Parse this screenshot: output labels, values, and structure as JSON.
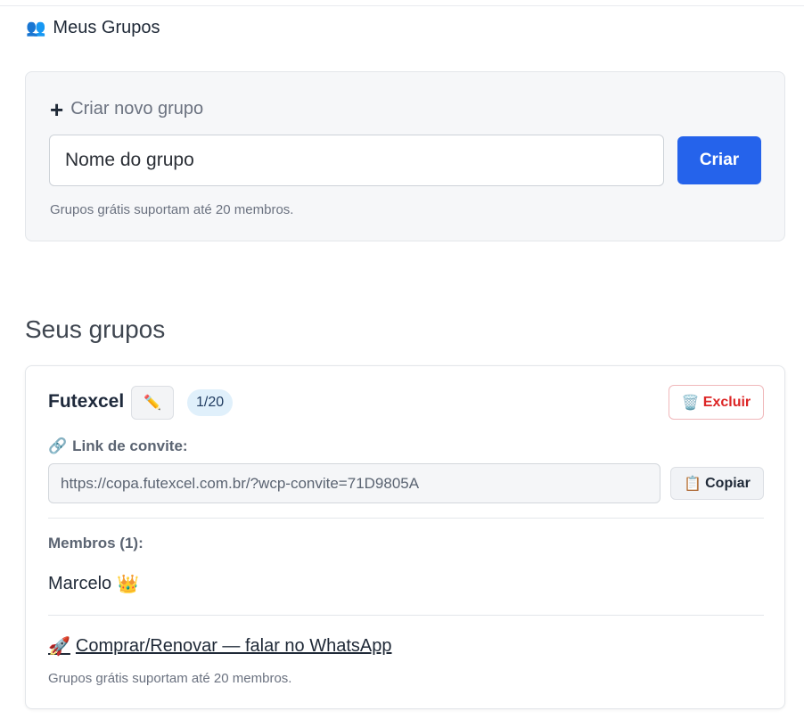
{
  "header": {
    "icon": "people-icon",
    "title": "Meus Grupos"
  },
  "create_group": {
    "title": "Criar novo grupo",
    "input_placeholder": "Nome do grupo",
    "input_value": "",
    "button_label": "Criar",
    "hint": "Grupos grátis suportam até 20 membros.",
    "button_color": "#2563eb"
  },
  "groups_section": {
    "title": "Seus grupos"
  },
  "group": {
    "name": "Futexcel",
    "member_count_badge": "1/20",
    "delete_label": "Excluir",
    "invite_label": "Link de convite:",
    "invite_link": "https://copa.futexcel.com.br/?wcp-convite=71D9805A",
    "copy_label": "Copiar",
    "members_title": "Membros (1):",
    "members": [
      {
        "name": "Marcelo",
        "badge_icon": "crown-icon"
      }
    ],
    "buy_link_label": "Comprar/Renovar — falar no WhatsApp",
    "hint": "Grupos grátis suportam até 20 membros.",
    "delete_color": "#dc2626"
  }
}
